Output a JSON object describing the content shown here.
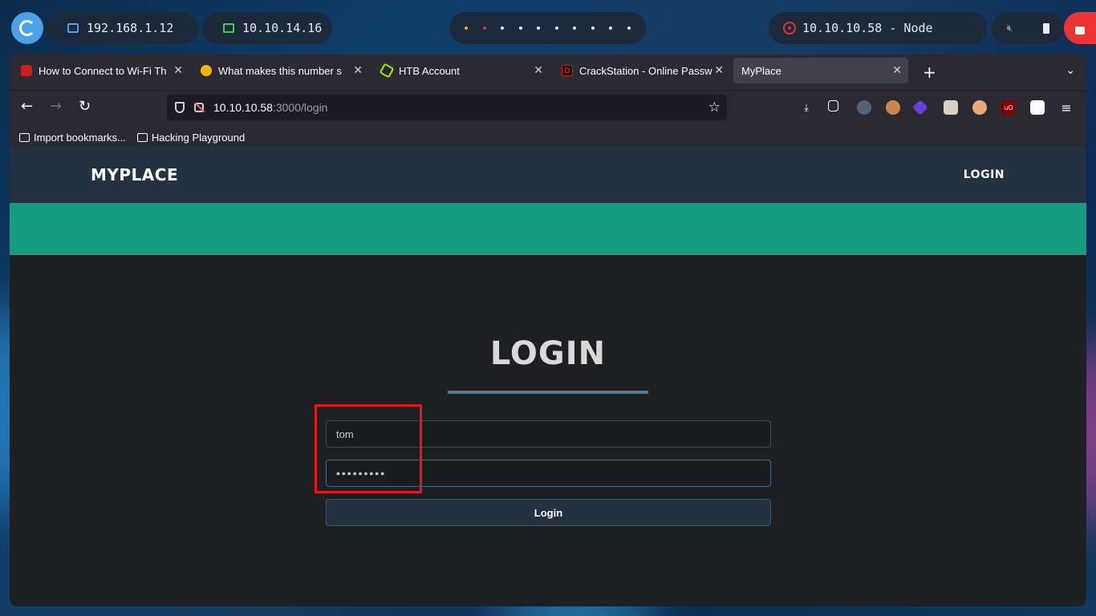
{
  "topbar": {
    "local_ip": "192.168.1.12",
    "vpn_ip": "10.10.14.16",
    "target": "10.10.10.58 - Node"
  },
  "browser": {
    "tabs": [
      {
        "title": "How to Connect to Wi-Fi Th",
        "favicon_color": "#d01c1c"
      },
      {
        "title": "What makes this number s",
        "favicon_color": "#f5b400"
      },
      {
        "title": "HTB Account",
        "favicon_color": "#9fef00"
      },
      {
        "title": "CrackStation - Online Passw",
        "favicon_color": "#d01c1c"
      },
      {
        "title": "MyPlace",
        "favicon_color": ""
      }
    ],
    "url_host": "10.10.10.58",
    "url_path": ":3000/login",
    "bookmarks": [
      {
        "label": "Import bookmarks..."
      },
      {
        "label": "Hacking Playground"
      }
    ]
  },
  "site": {
    "brand": "MYPLACE",
    "nav_login": "LOGIN",
    "heading": "LOGIN",
    "username_value": "tom",
    "password_value": "•••••••••",
    "login_button": "Login"
  },
  "colors": {
    "nav_bg": "#233140",
    "teal_band": "#169a80",
    "highlight": "#e01b1b"
  }
}
